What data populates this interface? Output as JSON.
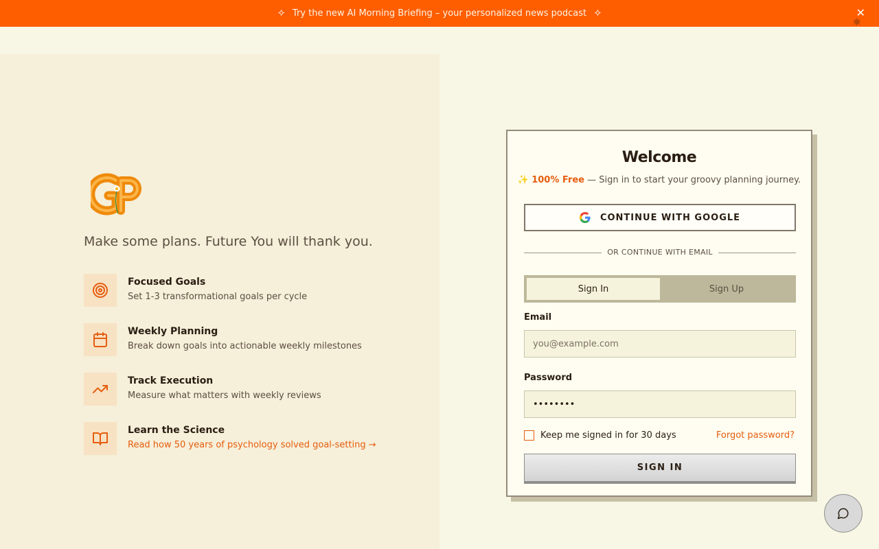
{
  "banner": {
    "text": "Try the new AI Morning Briefing – your personalized news podcast",
    "close_label": "✕"
  },
  "header": {
    "theme_icon": "☼"
  },
  "hero": {
    "tagline": "Make some plans. Future You will thank you.",
    "features": [
      {
        "icon": "target-icon",
        "title": "Focused Goals",
        "description": "Set 1-3 transformational goals per cycle"
      },
      {
        "icon": "calendar-icon",
        "title": "Weekly Planning",
        "description": "Break down goals into actionable weekly milestones"
      },
      {
        "icon": "trending-up-icon",
        "title": "Track Execution",
        "description": "Measure what matters with weekly reviews"
      },
      {
        "icon": "book-open-icon",
        "title": "Learn the Science",
        "link": "Read how 50 years of psychology solved goal-setting →"
      }
    ]
  },
  "auth": {
    "title": "Welcome",
    "subtitle_prefix": "✨ ",
    "subtitle_highlight": "100% Free",
    "subtitle_rest": " — Sign in to start your groovy planning journey.",
    "google_button": "CONTINUE WITH GOOGLE",
    "divider": "OR CONTINUE WITH EMAIL",
    "tabs": [
      {
        "label": "Sign In",
        "active": true
      },
      {
        "label": "Sign Up",
        "active": false
      }
    ],
    "email_label": "Email",
    "email_placeholder": "you@example.com",
    "password_label": "Password",
    "password_value": "••••••••",
    "remember_label": "Keep me signed in for 30 days",
    "forgot_link": "Forgot password?",
    "submit_button": "SIGN IN"
  },
  "colors": {
    "accent": "#ff5e00",
    "link": "#e65d0e",
    "page_bg": "#f8f7e5",
    "panel_bg": "#f6efd9"
  }
}
